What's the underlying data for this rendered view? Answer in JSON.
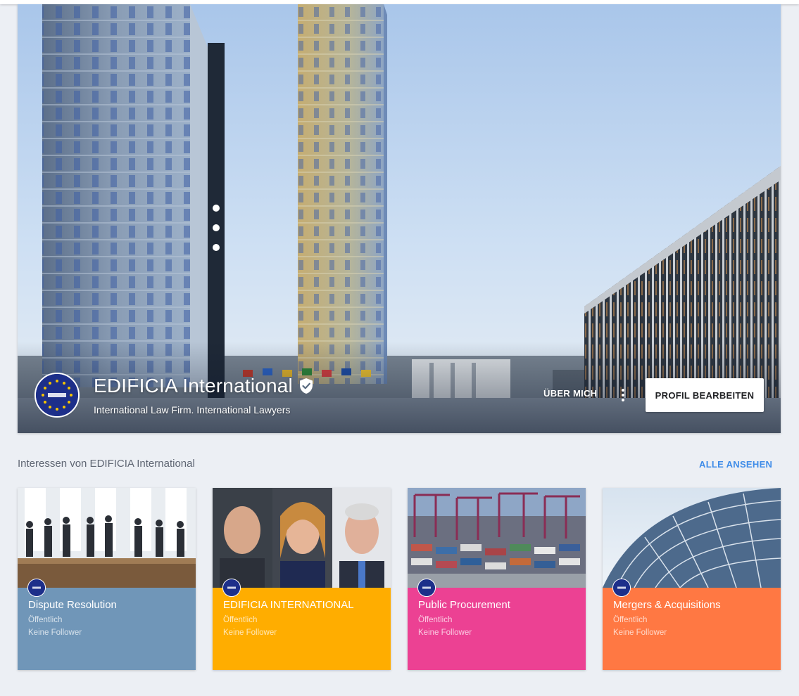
{
  "profile": {
    "name": "EDIFICIA International",
    "tagline": "International Law Firm. International Lawyers",
    "about_label": "ÜBER MICH",
    "edit_label": "PROFIL BEARBEITEN"
  },
  "interests": {
    "title": "Interessen von EDIFICIA International",
    "see_all_label": "ALLE ANSEHEN",
    "cards": [
      {
        "title": "Dispute Resolution",
        "visibility": "Öffentlich",
        "followers": "Keine Follower",
        "color": "#7096b8"
      },
      {
        "title": "EDIFICIA INTERNATIONAL",
        "visibility": "Öffentlich",
        "followers": "Keine Follower",
        "color": "#ffad00"
      },
      {
        "title": "Public Procurement",
        "visibility": "Öffentlich",
        "followers": "Keine Follower",
        "color": "#ec4193"
      },
      {
        "title": "Mergers & Acquisitions",
        "visibility": "Öffentlich",
        "followers": "Keine Follower",
        "color": "#ff7843"
      }
    ]
  },
  "colors": {
    "accent": "#3f8ce8",
    "background": "#eceff4"
  },
  "icons": {
    "verified": "verified-shield-icon",
    "more": "more-vertical-icon"
  }
}
